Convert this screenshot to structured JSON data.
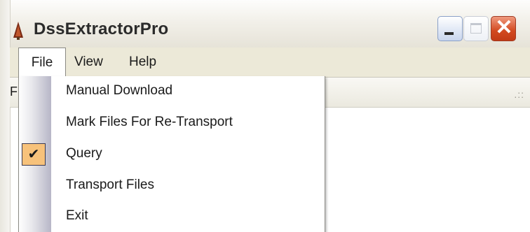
{
  "window": {
    "title": "DssExtractorPro",
    "app_icon": "pine-tree-icon",
    "controls": {
      "minimize": "minimize-icon",
      "maximize": "maximize-icon",
      "close": "close-icon",
      "close_glyph": "✕"
    }
  },
  "menubar": {
    "items": [
      {
        "label": "File",
        "open": true
      },
      {
        "label": "View"
      },
      {
        "label": "Help"
      }
    ]
  },
  "toolstrip": {
    "partial_text": "F",
    "grip": ".::"
  },
  "file_menu": {
    "items": [
      {
        "label": "Manual Download",
        "checked": false
      },
      {
        "label": "Mark Files For Re-Transport",
        "checked": false
      },
      {
        "label": "Query",
        "checked": true
      },
      {
        "label": "Transport Files",
        "checked": false
      },
      {
        "label": "Exit",
        "checked": false
      }
    ],
    "check_glyph": "✔"
  },
  "colors": {
    "menu_bg": "#ece9d8",
    "check_highlight": "#f7c27b",
    "close_button": "#d2491f"
  }
}
